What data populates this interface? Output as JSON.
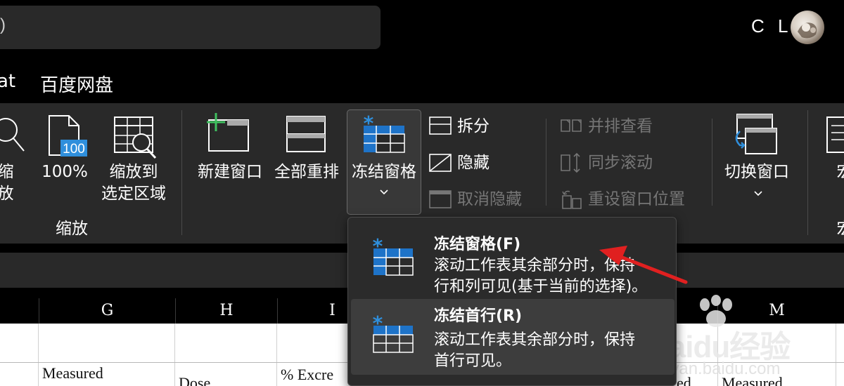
{
  "titlebar": {
    "search_fragment": ")",
    "user_name": "C L"
  },
  "menu": {
    "tabs": [
      "at",
      "百度网盘"
    ]
  },
  "ribbon": {
    "zoom_group": {
      "zoom_label_line1": "缩",
      "zoom_label_line2": "放",
      "zoom100_label": "100%",
      "zoom100_value": "100",
      "zoom_sel_line1": "缩放到",
      "zoom_sel_line2": "选定区域",
      "group_label": "缩放"
    },
    "window_group": {
      "new_window": "新建窗口",
      "arrange_all": "全部重排",
      "freeze_panes": "冻结窗格",
      "split": "拆分",
      "hide": "隐藏",
      "unhide": "取消隐藏",
      "side_by_side": "并排查看",
      "sync_scroll": "同步滚动",
      "reset_position": "重设窗口位置",
      "switch_window": "切换窗口",
      "macros_char": "宏",
      "macros_group_char": "宏"
    }
  },
  "dropdown": {
    "items": [
      {
        "title": "冻结窗格(F)",
        "desc_line1": "滚动工作表其余部分时，保持",
        "desc_line2": "行和列可见(基于当前的选择)。"
      },
      {
        "title": "冻结首行(R)",
        "desc_line1": "滚动工作表其余部分时，保持",
        "desc_line2": "首行可见。"
      }
    ]
  },
  "sheet": {
    "columns": [
      "G",
      "H",
      "I",
      "M"
    ],
    "cells": {
      "g_row2": "Measured",
      "h_row2": "Dose",
      "i_row2": "% Excre",
      "l_row2_fragment": "ed",
      "m_row2": "Measured"
    }
  },
  "watermark": {
    "brand": "Baidu经验",
    "url": "jingyan.baidu.com"
  },
  "colors": {
    "accent_blue": "#2f8fdc",
    "arrow_red": "#e02020",
    "ribbon_bg": "#292929"
  }
}
